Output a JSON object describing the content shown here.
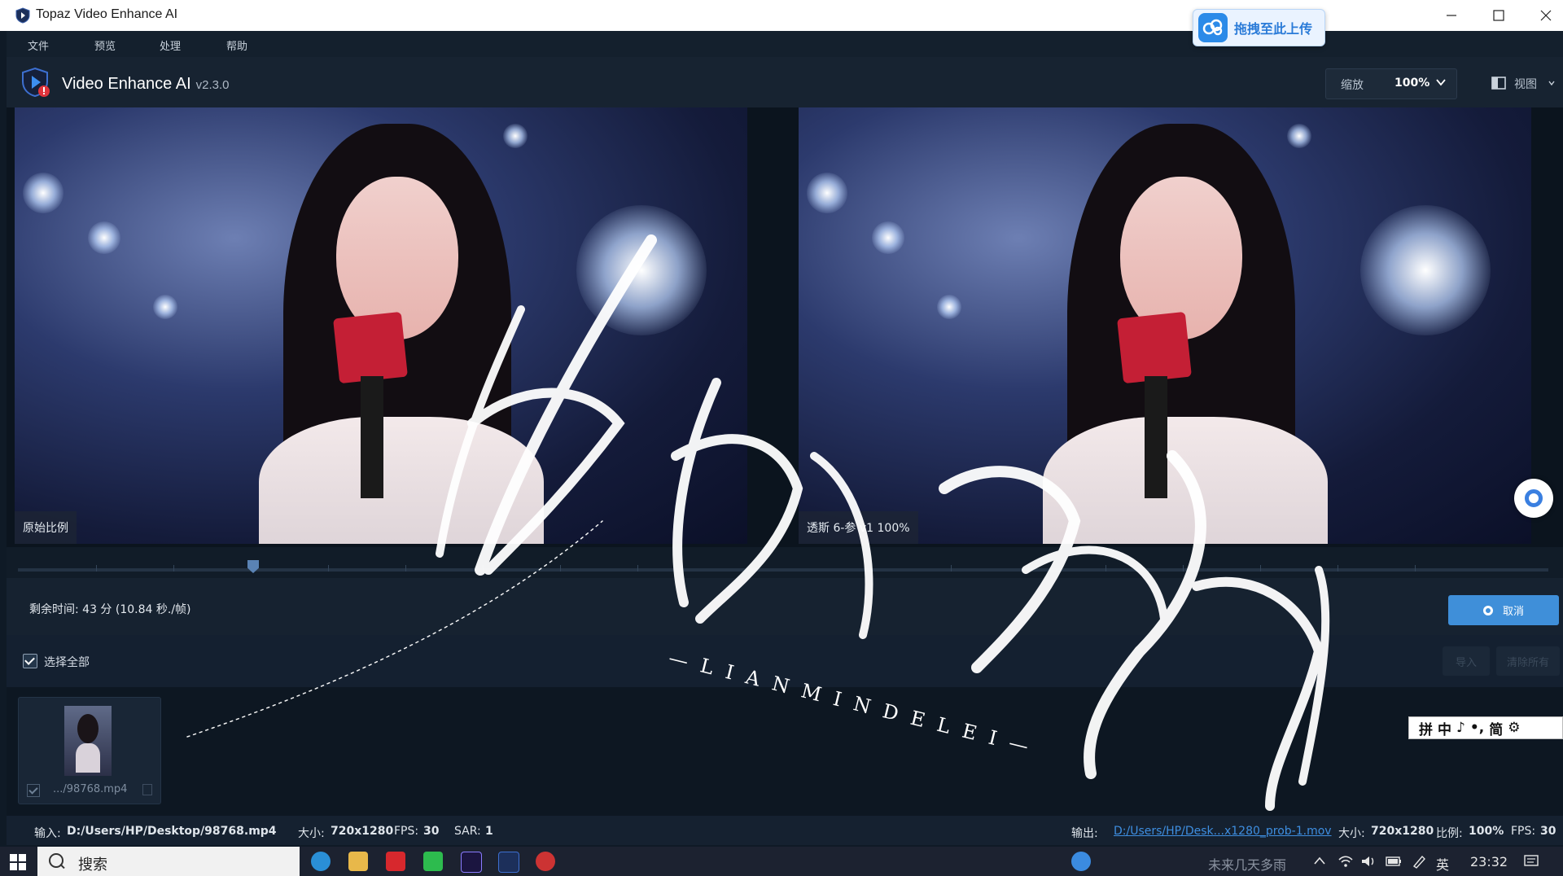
{
  "window": {
    "title": "Topaz Video Enhance AI"
  },
  "upload_widget": {
    "label": "拖拽至此上传"
  },
  "menu": [
    "文件",
    "预览",
    "处理",
    "帮助"
  ],
  "header": {
    "product": "Video Enhance AI",
    "version": "v2.3.0",
    "zoom_label": "缩放",
    "zoom_value": "100%",
    "view_label": "视图"
  },
  "preview": {
    "left_tag": "原始比例",
    "right_tag": "透斯 6-参 v1 100%"
  },
  "status": {
    "remaining": "剩余时间: 43 分 (10.84 秒./帧)",
    "cancel_label": "取消"
  },
  "selection": {
    "select_all_label": "选择全部",
    "import_label": "导入",
    "clear_label": "清除所有"
  },
  "files": [
    {
      "name": ".../98768.mp4"
    }
  ],
  "info": {
    "input_label": "输入:",
    "input_path": "D:/Users/HP/Desktop/98768.mp4",
    "size_label": "大小:",
    "size_value": "720x1280",
    "fps_label": "FPS:",
    "fps_value": "30",
    "sar_label": "SAR:",
    "sar_value": "1",
    "output_label": "输出:",
    "output_path": "D:/Users/HP/Desk...x1280_prob-1.mov",
    "out_size_label": "大小:",
    "out_size_value": "720x1280",
    "ratio_label": "比例:",
    "ratio_value": "100%",
    "out_fps_label": "FPS:",
    "out_fps_value": "30"
  },
  "overlay": {
    "latin": "—LIANMINDELEI—"
  },
  "ime_bar": {
    "items": [
      "拼",
      "中",
      "♪",
      "•,",
      "简",
      "⚙"
    ]
  },
  "taskbar": {
    "search_placeholder": "搜索",
    "tray_text": "未来几天多雨",
    "ime": "英",
    "time": "23:32"
  },
  "colors": {
    "accent": "#3f8fd9",
    "panel": "#162230",
    "link": "#3e8ee0"
  }
}
